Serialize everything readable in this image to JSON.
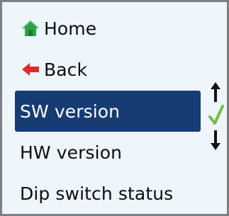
{
  "menu": {
    "items": [
      {
        "label": "Home",
        "icon": "home-icon",
        "icon_color": "#2aa24a"
      },
      {
        "label": "Back",
        "icon": "back-arrow-icon",
        "icon_color": "#e02a2a"
      },
      {
        "label": "SW version",
        "selected": true
      },
      {
        "label": "HW version"
      },
      {
        "label": "Dip switch status"
      }
    ]
  },
  "scroll": {
    "up_icon": "arrow-up-icon",
    "down_icon": "arrow-down-icon",
    "confirm_icon": "checkmark-icon",
    "confirm_color": "#6fc04a"
  },
  "colors": {
    "selection": "#173c74",
    "background": "#eef5fb",
    "border": "#7c7f84"
  }
}
